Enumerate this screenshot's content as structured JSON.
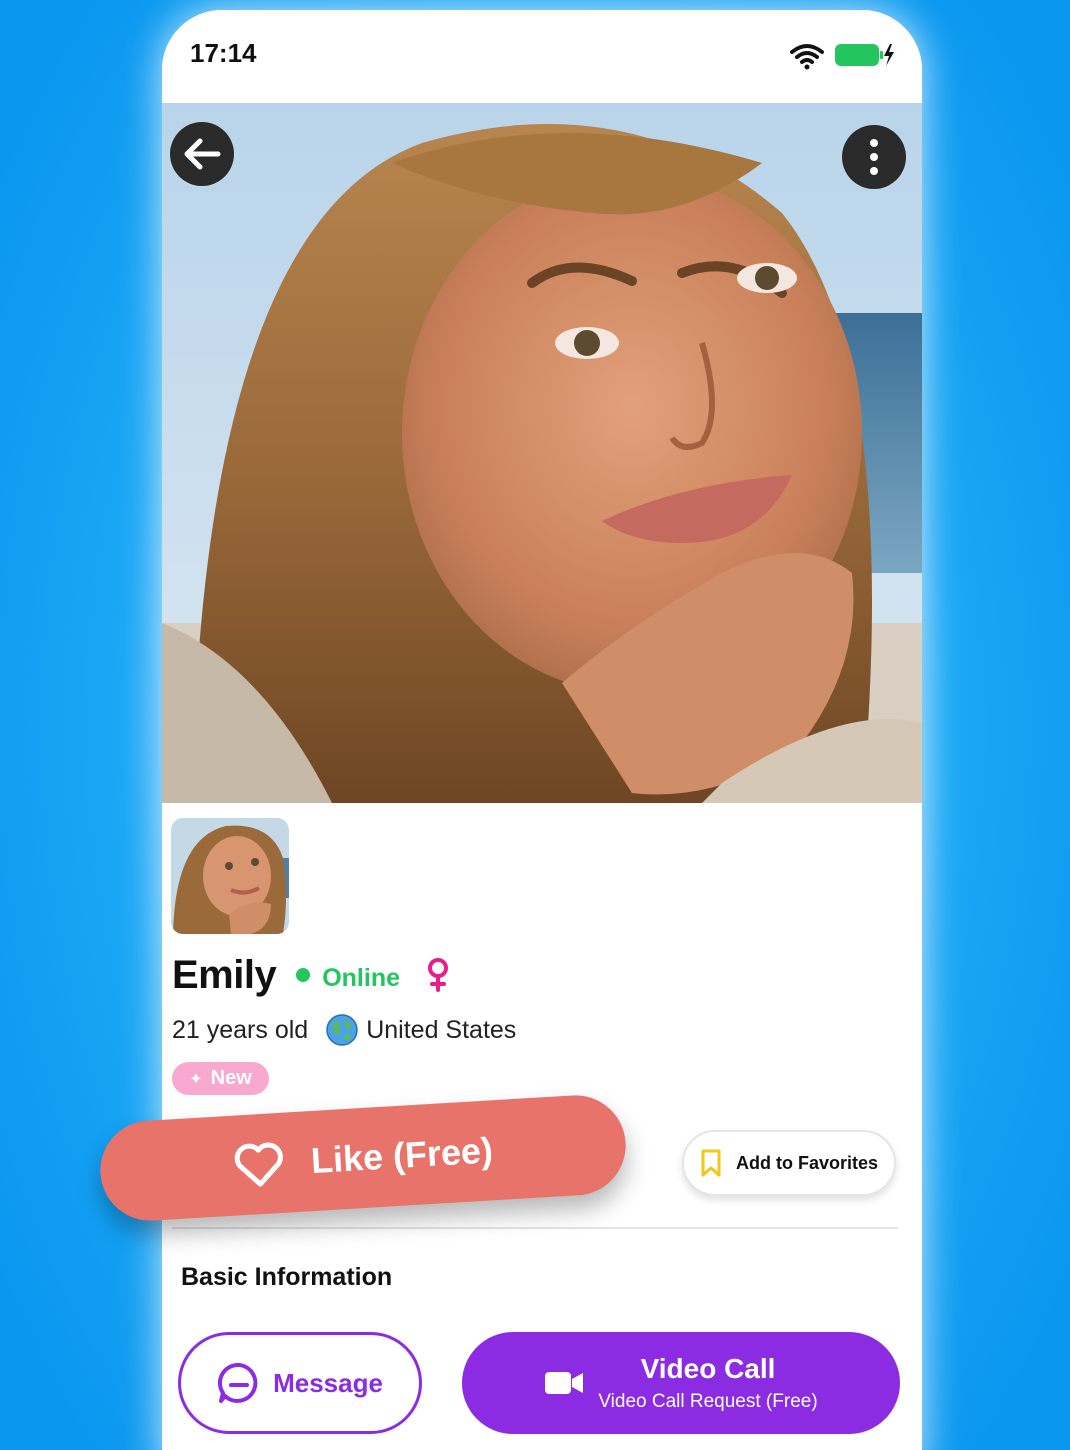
{
  "status_bar": {
    "time": "17:14"
  },
  "profile": {
    "name": "Emily",
    "status": "Online",
    "age": "21 years old",
    "country": "United States",
    "badge": "New"
  },
  "actions": {
    "like_label": "Like (Free)",
    "favorites_label": "Add to Favorites",
    "message_label": "Message",
    "video_call_title": "Video Call",
    "video_call_subtitle": "Video Call Request (Free)"
  },
  "sections": {
    "basic_info_title": "Basic Information"
  },
  "icons": [
    "back-arrow-icon",
    "more-vertical-icon",
    "wifi-icon",
    "battery-charging-icon",
    "female-icon",
    "globe-icon",
    "sparkle-icon",
    "heart-icon",
    "bookmark-icon",
    "chat-icon",
    "video-camera-icon"
  ],
  "colors": {
    "online": "#22c55e",
    "female": "#e91e8c",
    "like": "#e8736a",
    "primary": "#8b2be2",
    "badge": "#f9a8cf",
    "bookmark": "#f5c518",
    "background": "#1aa7f5"
  }
}
